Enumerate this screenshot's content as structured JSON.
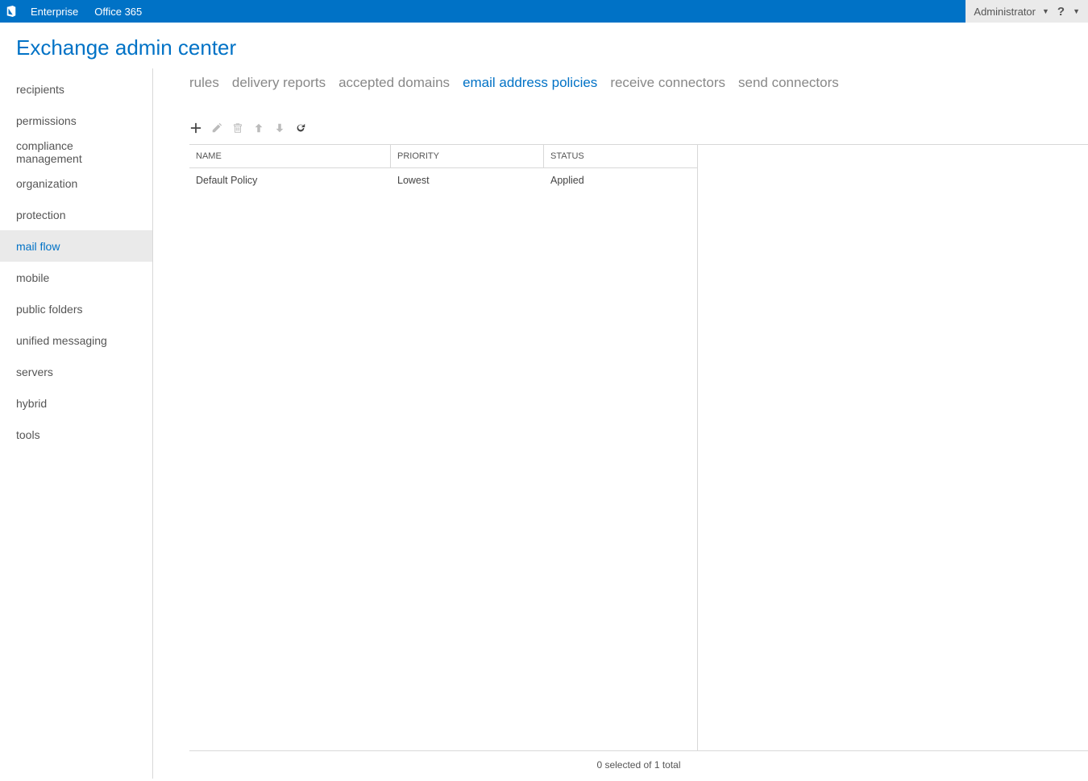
{
  "topbar": {
    "crumb1": "Enterprise",
    "crumb2": "Office 365",
    "user_label": "Administrator"
  },
  "page_title": "Exchange admin center",
  "sidebar": {
    "items": [
      {
        "label": "recipients"
      },
      {
        "label": "permissions"
      },
      {
        "label": "compliance management"
      },
      {
        "label": "organization"
      },
      {
        "label": "protection"
      },
      {
        "label": "mail flow",
        "active": true
      },
      {
        "label": "mobile"
      },
      {
        "label": "public folders"
      },
      {
        "label": "unified messaging"
      },
      {
        "label": "servers"
      },
      {
        "label": "hybrid"
      },
      {
        "label": "tools"
      }
    ]
  },
  "subtabs": [
    {
      "label": "rules"
    },
    {
      "label": "delivery reports"
    },
    {
      "label": "accepted domains"
    },
    {
      "label": "email address policies",
      "active": true
    },
    {
      "label": "receive connectors"
    },
    {
      "label": "send connectors"
    }
  ],
  "table": {
    "columns": {
      "name": "NAME",
      "priority": "PRIORITY",
      "status": "STATUS"
    },
    "rows": [
      {
        "name": "Default Policy",
        "priority": "Lowest",
        "status": "Applied"
      }
    ]
  },
  "status_line": "0 selected of 1 total"
}
